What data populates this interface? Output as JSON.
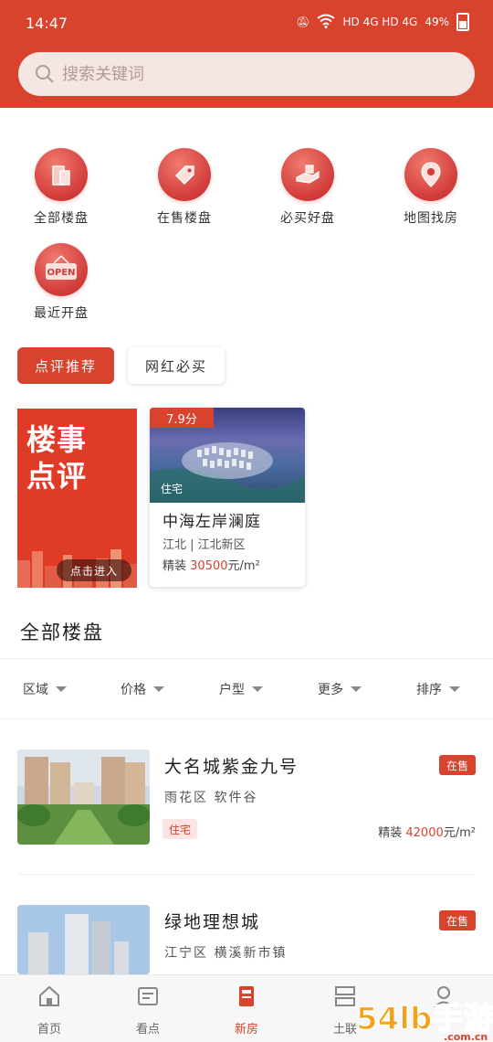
{
  "status_bar": {
    "time": "14:47",
    "signal": "HD 4G HD 4G",
    "battery": "49%"
  },
  "search": {
    "placeholder": "搜索关键词"
  },
  "categories": [
    {
      "label": "全部楼盘",
      "icon": "building-icon"
    },
    {
      "label": "在售楼盘",
      "icon": "tag-icon"
    },
    {
      "label": "必买好盘",
      "icon": "hand-icon"
    },
    {
      "label": "地图找房",
      "icon": "map-pin-icon"
    },
    {
      "label": "最近开盘",
      "icon": "open-sign-icon",
      "sign_text": "OPEN"
    }
  ],
  "tabs": [
    {
      "label": "点评推荐",
      "active": true
    },
    {
      "label": "网红必买",
      "active": false
    }
  ],
  "promo": {
    "title_line1": "楼事",
    "title_line2": "点评",
    "button": "点击进入"
  },
  "featured": {
    "score": "7.9分",
    "type": "住宅",
    "name": "中海左岸澜庭",
    "area": "江北 | 江北新区",
    "decoration": "精装",
    "price": "30500",
    "unit": "元/m²"
  },
  "section_title": "全部楼盘",
  "filters": [
    "区域",
    "价格",
    "户型",
    "更多",
    "排序"
  ],
  "listings": [
    {
      "name": "大名城紫金九号",
      "status": "在售",
      "location": "雨花区  软件谷",
      "tag": "住宅",
      "decoration": "精装",
      "price": "42000",
      "unit": "元/m²"
    },
    {
      "name": "绿地理想城",
      "status": "在售",
      "location": "江宁区  横溪新市镇"
    }
  ],
  "bottom_nav": [
    {
      "label": "首页",
      "icon": "home-icon",
      "active": false
    },
    {
      "label": "看点",
      "icon": "news-icon",
      "active": false
    },
    {
      "label": "新房",
      "icon": "new-house-icon",
      "active": true
    },
    {
      "label": "土联",
      "icon": "land-icon",
      "active": false
    },
    {
      "label": "",
      "icon": "profile-icon",
      "active": false
    }
  ],
  "watermark": {
    "text": "54lb手游网",
    "domain": ".com.cn"
  },
  "colors": {
    "brand": "#d8432e",
    "search_bg": "#f3e6e3",
    "price": "#d8432e"
  }
}
